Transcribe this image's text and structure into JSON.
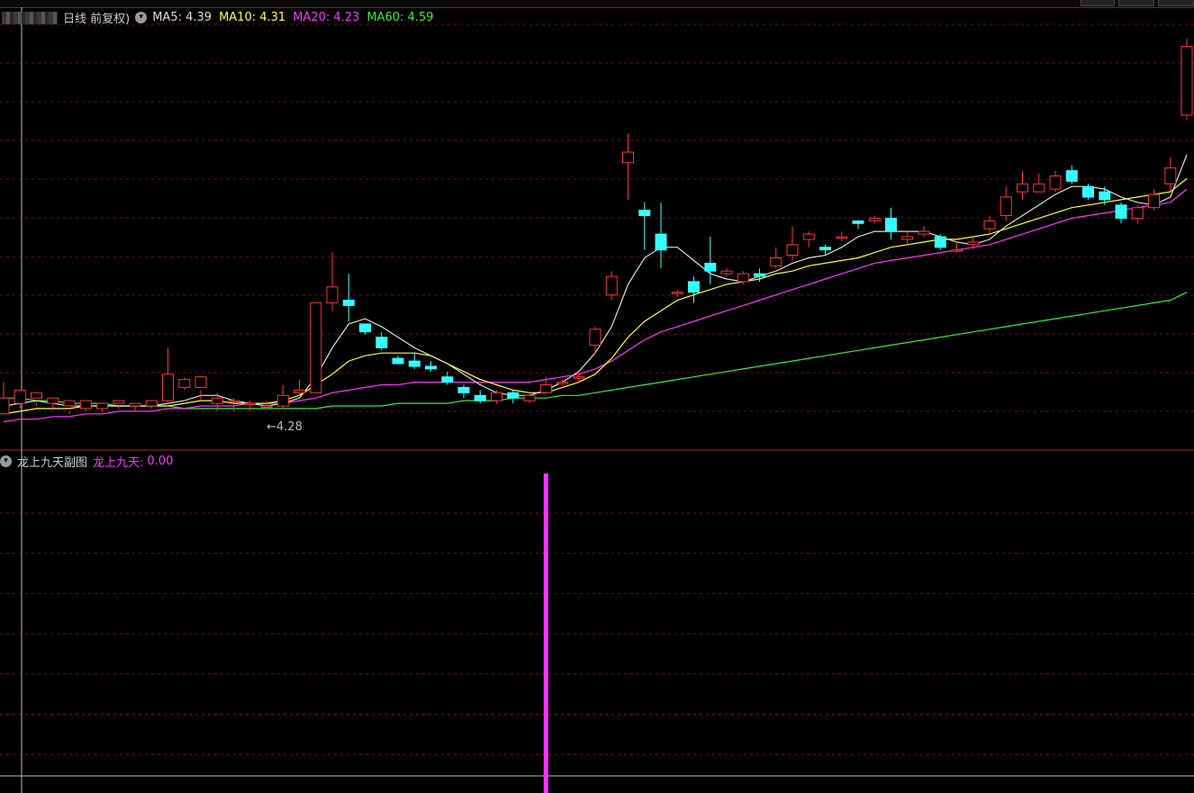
{
  "main_panel": {
    "title": "日线 前复权)",
    "indicators": [
      {
        "label": "MA5:",
        "value": "4.39",
        "color": "#dddddd"
      },
      {
        "label": "MA10:",
        "value": "4.31",
        "color": "#ffff33"
      },
      {
        "label": "MA20:",
        "value": "4.23",
        "color": "#ff33ff"
      },
      {
        "label": "MA60:",
        "value": "4.59",
        "color": "#33ee33"
      }
    ],
    "low_marker": "←4.28"
  },
  "sub_panel": {
    "title": "龙上九天副图",
    "indicator_label": "龙上九天:",
    "indicator_value": "0.00",
    "indicator_color": "#ff33ff"
  },
  "colors": {
    "up": "#ff3333",
    "down": "#33ffff",
    "grid": "#6a0f0f",
    "separator": "#b02020",
    "crosshair": "#bbbbbb",
    "ma5": "#dddddd",
    "ma10": "#ffff33",
    "ma20": "#ff33ff",
    "ma60": "#33ee33",
    "signal": "#ff33ff"
  },
  "chart_data": {
    "type": "candlestick",
    "ohlc": [
      [
        4.27,
        4.33,
        4.31,
        4.39
      ],
      [
        4.31,
        4.36,
        4.29,
        4.33
      ],
      [
        4.33,
        4.35,
        4.3,
        4.31
      ],
      [
        4.31,
        4.33,
        4.29,
        4.32
      ],
      [
        4.3,
        4.32,
        4.27,
        4.28
      ],
      [
        4.29,
        4.32,
        4.28,
        4.3
      ],
      [
        4.29,
        4.31,
        4.28,
        4.3
      ],
      [
        4.31,
        4.32,
        4.29,
        4.3
      ],
      [
        4.3,
        4.31,
        4.28,
        4.31
      ],
      [
        4.3,
        4.32,
        4.29,
        4.31
      ],
      [
        4.32,
        4.42,
        4.3,
        4.52
      ],
      [
        4.37,
        4.4,
        4.36,
        4.41
      ],
      [
        4.37,
        4.41,
        4.32,
        4.36
      ],
      [
        4.31,
        4.33,
        4.28,
        4.35
      ],
      [
        4.32,
        4.32,
        4.28,
        4.33
      ],
      [
        4.31,
        4.31,
        4.28,
        4.32
      ],
      [
        4.3,
        4.3,
        4.29,
        4.32
      ],
      [
        4.3,
        4.34,
        4.29,
        4.38
      ],
      [
        4.35,
        4.36,
        4.34,
        4.4
      ],
      [
        4.35,
        4.69,
        4.35,
        4.69
      ],
      [
        4.69,
        4.75,
        4.66,
        4.88
      ],
      [
        4.7,
        4.68,
        4.62,
        4.8
      ],
      [
        4.61,
        4.58,
        4.57,
        4.61
      ],
      [
        4.56,
        4.52,
        4.51,
        4.58
      ],
      [
        4.48,
        4.46,
        4.46,
        4.49
      ],
      [
        4.47,
        4.45,
        4.44,
        4.5
      ],
      [
        4.45,
        4.44,
        4.43,
        4.47
      ],
      [
        4.41,
        4.39,
        4.38,
        4.43
      ],
      [
        4.37,
        4.35,
        4.33,
        4.38
      ],
      [
        4.34,
        4.32,
        4.31,
        4.36
      ],
      [
        4.32,
        4.35,
        4.31,
        4.36
      ],
      [
        4.35,
        4.33,
        4.31,
        4.36
      ],
      [
        4.32,
        4.34,
        4.31,
        4.35
      ],
      [
        4.35,
        4.38,
        4.35,
        4.41
      ],
      [
        4.39,
        4.39,
        4.38,
        4.4
      ],
      [
        4.41,
        4.41,
        4.39,
        4.43
      ],
      [
        4.53,
        4.59,
        4.5,
        4.6
      ],
      [
        4.72,
        4.79,
        4.7,
        4.81
      ],
      [
        5.22,
        5.26,
        5.08,
        5.33
      ],
      [
        5.04,
        5.02,
        4.89,
        5.07
      ],
      [
        4.95,
        4.89,
        4.82,
        5.07
      ],
      [
        4.73,
        4.73,
        4.71,
        4.74
      ],
      [
        4.77,
        4.73,
        4.69,
        4.79
      ],
      [
        4.84,
        4.81,
        4.76,
        4.94
      ],
      [
        4.8,
        4.81,
        4.79,
        4.82
      ],
      [
        4.77,
        4.8,
        4.76,
        4.81
      ],
      [
        4.8,
        4.79,
        4.77,
        4.82
      ],
      [
        4.83,
        4.86,
        4.82,
        4.9
      ],
      [
        4.87,
        4.91,
        4.85,
        4.98
      ],
      [
        4.93,
        4.95,
        4.9,
        4.96
      ],
      [
        4.9,
        4.89,
        4.87,
        4.91
      ],
      [
        4.94,
        4.94,
        4.92,
        4.96
      ],
      [
        5.0,
        4.99,
        4.97,
        5.0
      ],
      [
        5.0,
        5.01,
        4.99,
        5.02
      ],
      [
        5.01,
        4.96,
        4.93,
        5.05
      ],
      [
        4.93,
        4.94,
        4.91,
        4.96
      ],
      [
        4.95,
        4.96,
        4.94,
        4.98
      ],
      [
        4.94,
        4.9,
        4.89,
        4.95
      ],
      [
        4.89,
        4.89,
        4.88,
        4.92
      ],
      [
        4.91,
        4.92,
        4.89,
        4.94
      ],
      [
        4.97,
        5.0,
        4.95,
        5.02
      ],
      [
        5.02,
        5.09,
        5.0,
        5.13
      ],
      [
        5.11,
        5.14,
        5.08,
        5.19
      ],
      [
        5.11,
        5.14,
        5.11,
        5.18
      ],
      [
        5.12,
        5.17,
        5.11,
        5.19
      ],
      [
        5.19,
        5.15,
        5.14,
        5.21
      ],
      [
        5.13,
        5.09,
        5.08,
        5.14
      ],
      [
        5.11,
        5.08,
        5.06,
        5.13
      ],
      [
        5.06,
        5.01,
        4.99,
        5.07
      ],
      [
        5.01,
        5.05,
        4.99,
        5.06
      ],
      [
        5.05,
        5.1,
        5.04,
        5.12
      ],
      [
        5.14,
        5.2,
        5.11,
        5.24
      ],
      [
        5.4,
        5.66,
        5.38,
        5.69
      ]
    ],
    "ma5": [
      4.3,
      4.31,
      4.32,
      4.31,
      4.3,
      4.3,
      4.3,
      4.3,
      4.3,
      4.3,
      4.31,
      4.32,
      4.34,
      4.34,
      4.32,
      4.31,
      4.3,
      4.31,
      4.33,
      4.41,
      4.52,
      4.61,
      4.63,
      4.6,
      4.56,
      4.52,
      4.49,
      4.46,
      4.42,
      4.38,
      4.35,
      4.34,
      4.34,
      4.36,
      4.39,
      4.43,
      4.5,
      4.6,
      4.76,
      4.86,
      4.9,
      4.9,
      4.85,
      4.8,
      4.78,
      4.77,
      4.79,
      4.81,
      4.84,
      4.86,
      4.87,
      4.9,
      4.94,
      4.96,
      4.96,
      4.96,
      4.96,
      4.94,
      4.92,
      4.91,
      4.93,
      4.98,
      5.02,
      5.06,
      5.1,
      5.13,
      5.13,
      5.12,
      5.09,
      5.07,
      5.06,
      5.09,
      5.25
    ],
    "ma10": [
      4.27,
      4.28,
      4.29,
      4.29,
      4.29,
      4.3,
      4.3,
      4.3,
      4.3,
      4.3,
      4.3,
      4.31,
      4.32,
      4.32,
      4.31,
      4.31,
      4.31,
      4.32,
      4.34,
      4.38,
      4.42,
      4.47,
      4.49,
      4.5,
      4.5,
      4.5,
      4.49,
      4.46,
      4.43,
      4.4,
      4.38,
      4.36,
      4.35,
      4.35,
      4.37,
      4.39,
      4.42,
      4.48,
      4.56,
      4.62,
      4.66,
      4.7,
      4.72,
      4.74,
      4.76,
      4.77,
      4.78,
      4.8,
      4.81,
      4.83,
      4.84,
      4.85,
      4.86,
      4.88,
      4.9,
      4.91,
      4.92,
      4.93,
      4.93,
      4.94,
      4.95,
      4.97,
      4.99,
      5.01,
      5.03,
      5.05,
      5.06,
      5.07,
      5.08,
      5.09,
      5.1,
      5.11,
      5.16
    ],
    "ma20": [
      4.24,
      4.25,
      4.25,
      4.26,
      4.26,
      4.27,
      4.27,
      4.28,
      4.28,
      4.28,
      4.29,
      4.29,
      4.3,
      4.3,
      4.3,
      4.31,
      4.31,
      4.31,
      4.32,
      4.33,
      4.35,
      4.36,
      4.37,
      4.38,
      4.38,
      4.39,
      4.39,
      4.39,
      4.39,
      4.39,
      4.39,
      4.39,
      4.39,
      4.4,
      4.41,
      4.42,
      4.44,
      4.47,
      4.51,
      4.55,
      4.58,
      4.6,
      4.62,
      4.64,
      4.66,
      4.68,
      4.7,
      4.72,
      4.74,
      4.76,
      4.78,
      4.8,
      4.82,
      4.84,
      4.85,
      4.86,
      4.87,
      4.88,
      4.89,
      4.9,
      4.91,
      4.93,
      4.95,
      4.97,
      4.99,
      5.01,
      5.02,
      5.03,
      5.04,
      5.05,
      5.06,
      5.07,
      5.12
    ],
    "ma60": [
      4.33,
      4.33,
      4.32,
      4.32,
      4.31,
      4.31,
      4.31,
      4.3,
      4.3,
      4.3,
      4.3,
      4.29,
      4.29,
      4.29,
      4.29,
      4.29,
      4.29,
      4.29,
      4.29,
      4.29,
      4.3,
      4.3,
      4.3,
      4.3,
      4.31,
      4.31,
      4.31,
      4.31,
      4.32,
      4.32,
      4.32,
      4.33,
      4.33,
      4.33,
      4.34,
      4.34,
      4.35,
      4.36,
      4.37,
      4.38,
      4.39,
      4.4,
      4.41,
      4.42,
      4.43,
      4.44,
      4.45,
      4.46,
      4.47,
      4.48,
      4.49,
      4.5,
      4.51,
      4.52,
      4.53,
      4.54,
      4.55,
      4.56,
      4.57,
      4.58,
      4.59,
      4.6,
      4.61,
      4.62,
      4.63,
      4.64,
      4.65,
      4.66,
      4.67,
      4.68,
      4.69,
      4.7,
      4.73
    ],
    "price_range": [
      4.14,
      5.74
    ],
    "signal_index": 33
  }
}
